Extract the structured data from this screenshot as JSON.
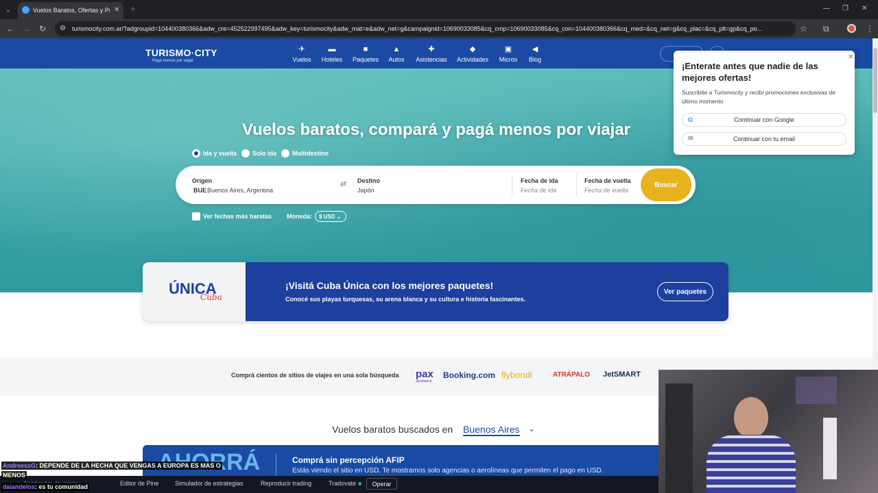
{
  "browser": {
    "tab_title": "Vuelos Baratos, Ofertas y Prom",
    "url": "turismocity.com.ar/?adgroupid=104400380366&adw_cre=452522997495&adw_key=turismocity&adw_mat=e&adw_net=g&campaignid=10690033085&cq_cmp=10690033085&cq_con=104400380366&cq_med=&cq_net=g&cq_plac=&cq_plt=gp&cq_po..."
  },
  "brand": {
    "name": "TURISMO·CITY",
    "tagline": "Pagá menos por viajar",
    "color": "#1a4aa3"
  },
  "nav": [
    {
      "label": "Vuelos",
      "icon": "plane-icon"
    },
    {
      "label": "Hoteles",
      "icon": "bed-icon"
    },
    {
      "label": "Paquetes",
      "icon": "suitcase-icon"
    },
    {
      "label": "Autos",
      "icon": "car-icon"
    },
    {
      "label": "Asistencias",
      "icon": "medkit-icon"
    },
    {
      "label": "Actividades",
      "icon": "ticket-icon"
    },
    {
      "label": "Micros",
      "icon": "bus-icon"
    },
    {
      "label": "Blog",
      "icon": "megaphone-icon"
    }
  ],
  "hero": {
    "title": "Vuelos baratos, compará y pagá menos por viajar",
    "trip_types": [
      "Ida y vuelta",
      "Solo ida",
      "Multidestino"
    ],
    "origin_label": "Origen",
    "origin_code": "BUE",
    "origin_value": "Buenos Aires, Argentina",
    "destination_label": "Destino",
    "destination_value": "Japón",
    "depart_label": "Fecha de ida",
    "depart_placeholder": "Fecha de ida",
    "return_label": "Fecha de vuelta",
    "return_placeholder": "Fecha de vuelta",
    "search_button": "Buscar",
    "search_color": "#e8b31c",
    "cheap_dates": "Ver fechas más baratas",
    "currency_label": "Moneda:",
    "currency_value": "$ USD"
  },
  "cuba": {
    "logo_main": "ÚNICA",
    "logo_sub": "Cuba",
    "title": "¡Visitá Cuba Única con los mejores paquetes!",
    "subtitle": "Conocé sus playas turquesas, su arena blanca y su cultura e historia fascinantes.",
    "button": "Ver paquetes"
  },
  "compare": {
    "text": "Comprá cientos de sitios de viajes en una sola búsqueda",
    "logos": [
      "pax",
      "Booking.com",
      "flybondi",
      "ATRÁPALO",
      "JetSMART"
    ],
    "pax_sub": "assistance"
  },
  "cheap_flights": {
    "prefix": "Vuelos baratos buscados en",
    "city": "Buenos Aires"
  },
  "afip": {
    "big": "AHORRÁ",
    "title": "Comprá sin percepción AFIP",
    "text": "Estás viendo el sitio en USD. Te mostramos solo agencias o aerolíneas que permiten el pago en USD."
  },
  "popup": {
    "title": "¡Enterate antes que nadie de las mejores ofertas!",
    "text": "Suscribite a Turismocity y recibí promociones exclusivas de último momento",
    "google_btn": "Continuar con Google",
    "email_btn": "Continuar con tu email"
  },
  "chat": [
    {
      "user": "AndreessG",
      "msg": ": DEPENDE DE LA HECHA QUE VENGAS A EUROPA ES MAS O"
    },
    {
      "user": "",
      "msg": "MENOS"
    },
    {
      "user": "daiandelos",
      "msg": ": es tu comunidad"
    }
  ],
  "bottom_bar": {
    "items": [
      "Analizador de cripto",
      "Editor de Pine",
      "Simulador de estrategias",
      "Reproducir trading",
      "Tradovate"
    ],
    "operate": "Operar"
  }
}
